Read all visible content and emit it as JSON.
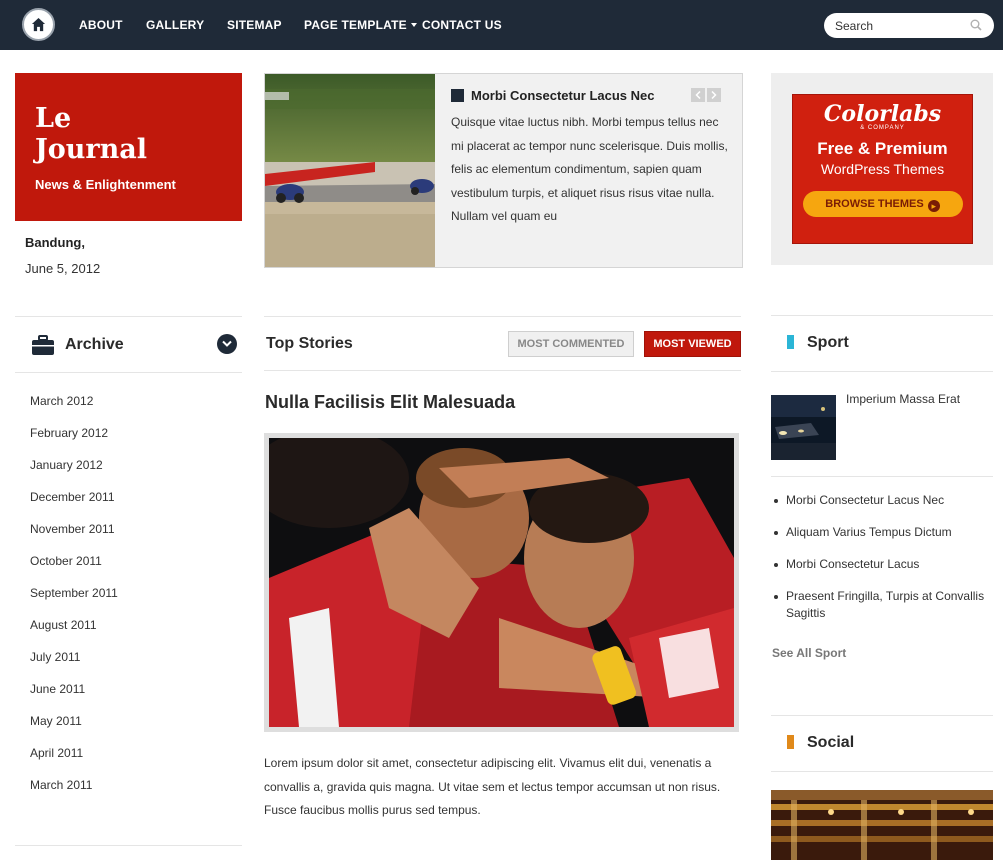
{
  "nav": {
    "items": [
      {
        "label": "ABOUT"
      },
      {
        "label": "GALLERY"
      },
      {
        "label": "SITEMAP"
      },
      {
        "label": "PAGE TEMPLATE"
      },
      {
        "label": "CONTACT US"
      }
    ],
    "search_placeholder": "Search"
  },
  "site": {
    "title_line1": "Le",
    "title_line2": "Journal",
    "tagline": "News & Enlightenment",
    "city": "Bandung,",
    "date": "June 5, 2012"
  },
  "archive": {
    "title": "Archive",
    "items": [
      "March 2012",
      "February 2012",
      "January 2012",
      "December 2011",
      "November 2011",
      "October 2011",
      "September 2011",
      "August 2011",
      "July 2011",
      "June 2011",
      "May 2011",
      "April 2011",
      "March 2011"
    ]
  },
  "feature": {
    "title": "Morbi Consectetur Lacus Nec",
    "body": "Quisque vitae luctus nibh. Morbi tempus tellus nec mi placerat ac tempor nunc scelerisque. Duis mollis, felis ac elementum condimentum, sapien quam vestibulum turpis, et aliquet risus risus vitae nulla. Nullam vel quam eu"
  },
  "top_stories": {
    "title": "Top Stories",
    "tab_commented": "MOST COMMENTED",
    "tab_viewed": "MOST VIEWED",
    "story_title": "Nulla Facilisis Elit Malesuada",
    "story_body": "Lorem ipsum dolor sit amet, consectetur adipiscing elit. Vivamus elit dui, venenatis a convallis a, gravida quis magna. Ut vitae sem et lectus tempor accumsan ut non risus. Fusce faucibus mollis purus sed tempus."
  },
  "ad": {
    "brand": "Colorlabs",
    "company": "& COMPANY",
    "line1": "Free & Premium",
    "line2": "WordPress Themes",
    "button": "BROWSE THEMES"
  },
  "sport": {
    "title": "Sport",
    "featured": "Imperium Massa Erat",
    "items": [
      "Morbi Consectetur Lacus Nec",
      "Aliquam Varius Tempus Dictum",
      "Morbi Consectetur Lacus",
      "Praesent Fringilla, Turpis at Convallis Sagittis"
    ],
    "see_all": "See All Sport",
    "accent": "#2bb5d6"
  },
  "social": {
    "title": "Social",
    "accent": "#e0891a"
  },
  "colors": {
    "nav_bg": "#1f2a38",
    "brand_red": "#c0180c"
  }
}
